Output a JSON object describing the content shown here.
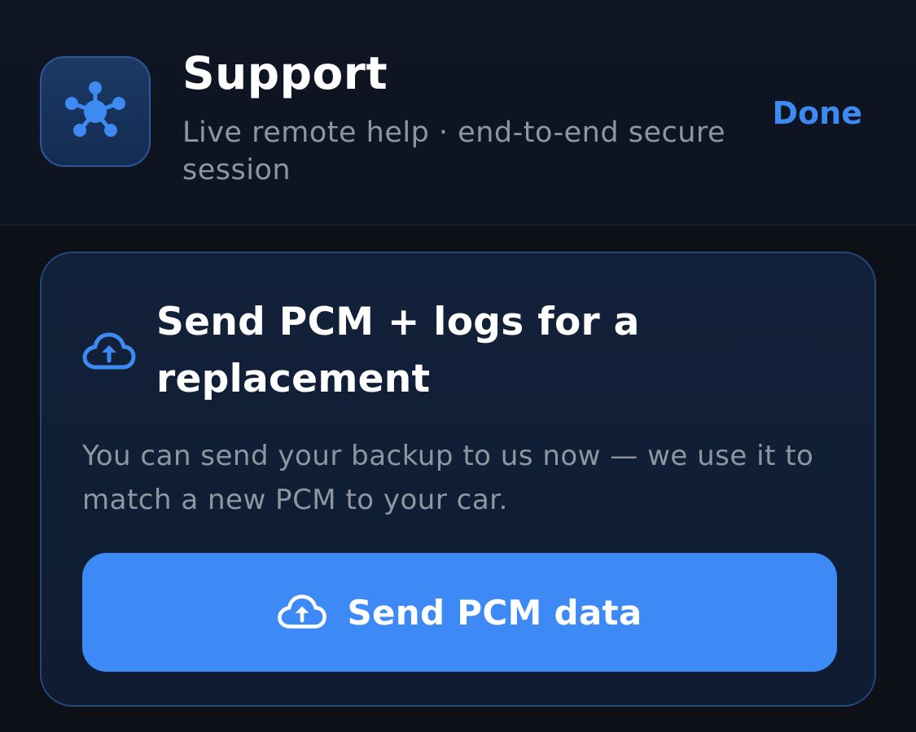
{
  "header": {
    "title": "Support",
    "subtitle": "Live remote help · end-to-end secure session",
    "done_label": "Done",
    "app_icon": "network-hub-icon"
  },
  "card": {
    "icon": "cloud-upload-icon",
    "title": "Send PCM + logs for a replacement",
    "body": "You can send your backup to us now — we use it to match a new PCM to your car.",
    "button": {
      "icon": "cloud-upload-icon",
      "label": "Send PCM data"
    }
  },
  "colors": {
    "accent": "#3d8af7",
    "background": "#0d1016",
    "card_border": "#24487d"
  }
}
